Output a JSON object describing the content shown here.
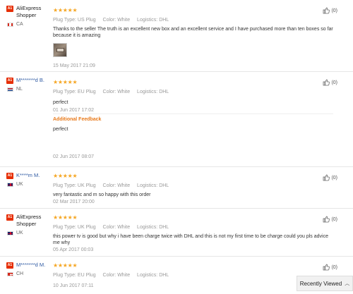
{
  "ui": {
    "stars": "★★★★★",
    "plug_label": "Plug Type:",
    "color_label": "Color:",
    "logistics_label": "Logistics:"
  },
  "colors": {
    "accent": "#e62e04",
    "stars": "#f5a623",
    "link": "#2f5aa3",
    "additional": "#e8791a"
  },
  "reviews": [
    {
      "badge": "A1",
      "name": "AliExpress Shopper",
      "country": "CA",
      "flag": "flag-ca",
      "plug": "US Plug",
      "color": "White",
      "logistics": "DHL",
      "text": "Thanks to the seller The truth is an excellent new box and an excellent service and I have purchased more than ten boxes so far because it is amazing",
      "date": "15 May 2017 21:09",
      "helpful": "(0)"
    },
    {
      "badge": "A1",
      "name": "M*******d B.",
      "country": "NL",
      "flag": "flag-nl",
      "plug": "EU Plug",
      "color": "White",
      "logistics": "DHL",
      "text": "perfect",
      "date": "01 Jun 2017 17:02",
      "helpful": "(0)",
      "additional_title": "Additional Feedback",
      "additional_text": "perfect",
      "additional_date": "02 Jun 2017 08:07"
    },
    {
      "badge": "A1",
      "name": "K****m M.",
      "country": "UK",
      "flag": "flag-uk",
      "plug": "UK Plug",
      "color": "White",
      "logistics": "DHL",
      "text": "very fantastic and m so happy with this order",
      "date": "02 Mar 2017 20:00",
      "helpful": "(0)"
    },
    {
      "badge": "A1",
      "name": "AliExpress Shopper",
      "country": "UK",
      "flag": "flag-uk",
      "plug": "UK Plug",
      "color": "White",
      "logistics": "DHL",
      "text": "this power tv is good but why i have been charge twice with DHL and this is not my first time to be charge could you pls advice me why",
      "date": "05 Apr 2017 00:03",
      "helpful": "(0)"
    },
    {
      "badge": "A1",
      "name": "M*******d M.",
      "country": "CH",
      "flag": "flag-ch",
      "plug": "EU Plug",
      "color": "White",
      "logistics": "DHL",
      "date": "10 Jun 2017 07:11",
      "helpful": "(0)"
    }
  ],
  "recently_viewed": {
    "label": "Recently Viewed",
    "icon": "chevron-up-icon"
  }
}
